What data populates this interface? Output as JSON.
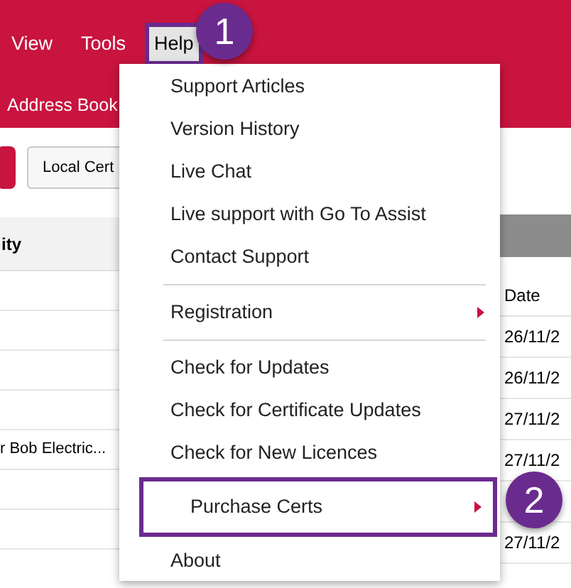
{
  "menu_bar": [
    {
      "label": "View",
      "selected": false,
      "highlighted": false
    },
    {
      "label": "Tools",
      "selected": false,
      "highlighted": false
    },
    {
      "label": "Help",
      "selected": true,
      "highlighted": true
    }
  ],
  "toolbar": {
    "tab": "Address Book"
  },
  "buttons": [
    "Local Cert"
  ],
  "left_panel": {
    "header": "ity",
    "rows": [
      {
        "kind": "blank"
      },
      {
        "kind": "blank"
      },
      {
        "kind": "blank"
      },
      {
        "kind": "blank"
      },
      {
        "kind": "text",
        "text": "r Bob Electric..."
      },
      {
        "kind": "blank"
      },
      {
        "kind": "blank"
      },
      {
        "kind": "blank"
      }
    ]
  },
  "right_panel": {
    "header": "Date",
    "rows": [
      {
        "kind": "text",
        "text": "26/11/2"
      },
      {
        "kind": "text",
        "text": "26/11/2"
      },
      {
        "kind": "text",
        "text": "27/11/2"
      },
      {
        "kind": "text",
        "text": "27/11/2"
      },
      {
        "kind": "blank"
      },
      {
        "kind": "text",
        "text": "27/11/2"
      }
    ]
  },
  "help_menu": [
    {
      "kind": "item",
      "label": "Support Articles",
      "highlighted": false
    },
    {
      "kind": "item",
      "label": "Version History",
      "highlighted": false
    },
    {
      "kind": "item",
      "label": "Live Chat",
      "highlighted": false
    },
    {
      "kind": "item",
      "label": "Live support with Go To Assist",
      "highlighted": false
    },
    {
      "kind": "item",
      "label": "Contact Support",
      "highlighted": false
    },
    {
      "kind": "separator"
    },
    {
      "kind": "submenu",
      "label": "Registration",
      "highlighted": false
    },
    {
      "kind": "separator"
    },
    {
      "kind": "item",
      "label": "Check for Updates",
      "highlighted": false
    },
    {
      "kind": "item",
      "label": "Check for Certificate Updates",
      "highlighted": false
    },
    {
      "kind": "item",
      "label": "Check for New Licences",
      "highlighted": false
    },
    {
      "kind": "submenu",
      "label": "Purchase Certs",
      "highlighted": true
    },
    {
      "kind": "item",
      "label": "About",
      "highlighted": false
    }
  ],
  "callouts": [
    "1",
    "2"
  ]
}
